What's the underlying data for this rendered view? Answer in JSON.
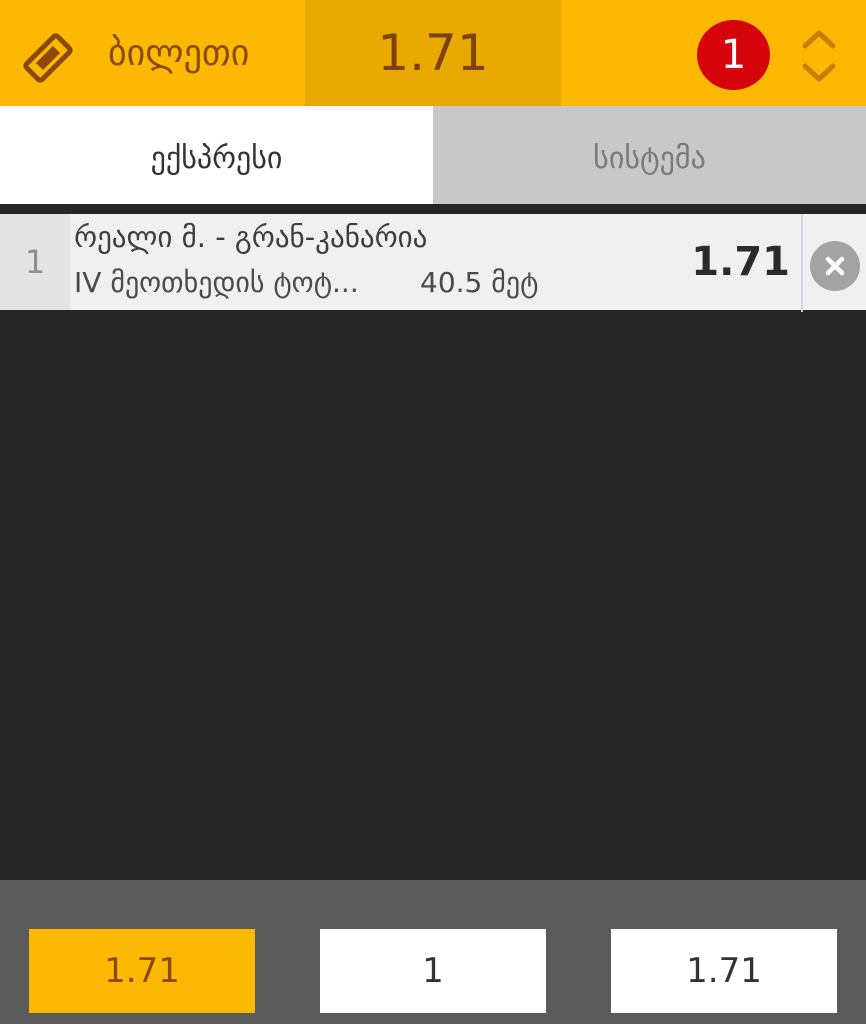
{
  "header": {
    "ticket_icon": "ticket-icon",
    "ticket_label": "ბილეთი",
    "total_odds": "1.71",
    "selection_count": "1",
    "toggle_icon": "chevron-up-down-icon",
    "colors": {
      "accent": "#FDB803",
      "accent_dark": "#EAA900",
      "badge": "#D6040B",
      "text_brown": "#8A4A0E"
    }
  },
  "tabs": [
    {
      "label": "ექსპრესი",
      "active": true
    },
    {
      "label": "სისტემა",
      "active": false
    }
  ],
  "bets": [
    {
      "index": "1",
      "match": "რეალი მ. - გრან-კანარია",
      "market": "IV მეოთხედის ტოტ...",
      "outcome": "40.5 მეტ",
      "odds": "1.71",
      "remove_icon": "close-circle-icon"
    }
  ],
  "footer": {
    "total_odds": "1.71",
    "stake": "1",
    "possible_win": "1.71"
  }
}
